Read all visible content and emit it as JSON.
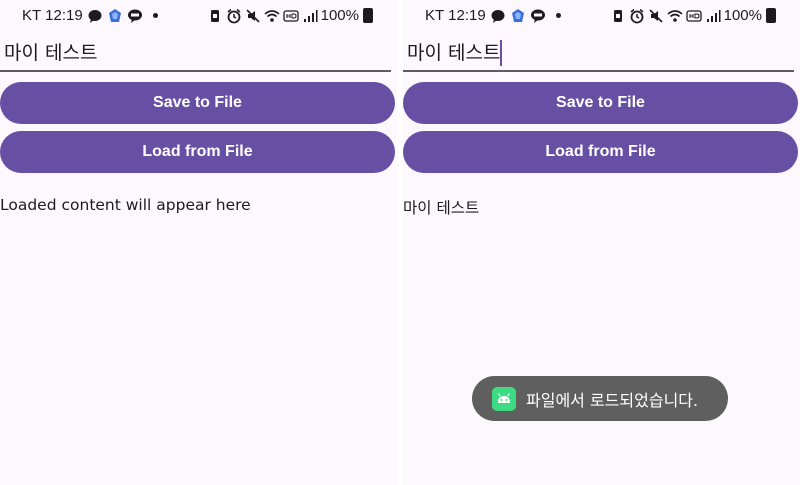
{
  "status_bar": {
    "carrier": "KT",
    "time": "12:19",
    "battery_percent": "100%"
  },
  "left_screen": {
    "text_field_value": "마이 테스트",
    "save_button": "Save to File",
    "load_button": "Load from File",
    "loaded_text": "Loaded content will appear here"
  },
  "right_screen": {
    "text_field_value": "마이 테스트",
    "save_button": "Save to File",
    "load_button": "Load from File",
    "loaded_text": "마이 테스트",
    "toast_message": "파일에서 로드되었습니다."
  },
  "colors": {
    "primary": "#6750a4",
    "background": "#fdf7fe",
    "toast_bg": "#5f5f5f",
    "android_green": "#3ddc84"
  },
  "icons": [
    "message-bubble-icon",
    "app-gem-icon",
    "talk-icon",
    "notification-dot-icon",
    "sim-lock-icon",
    "alarm-icon",
    "mute-icon",
    "wifi-icon",
    "hd-icon",
    "signal-icon",
    "battery-icon",
    "android-icon"
  ]
}
